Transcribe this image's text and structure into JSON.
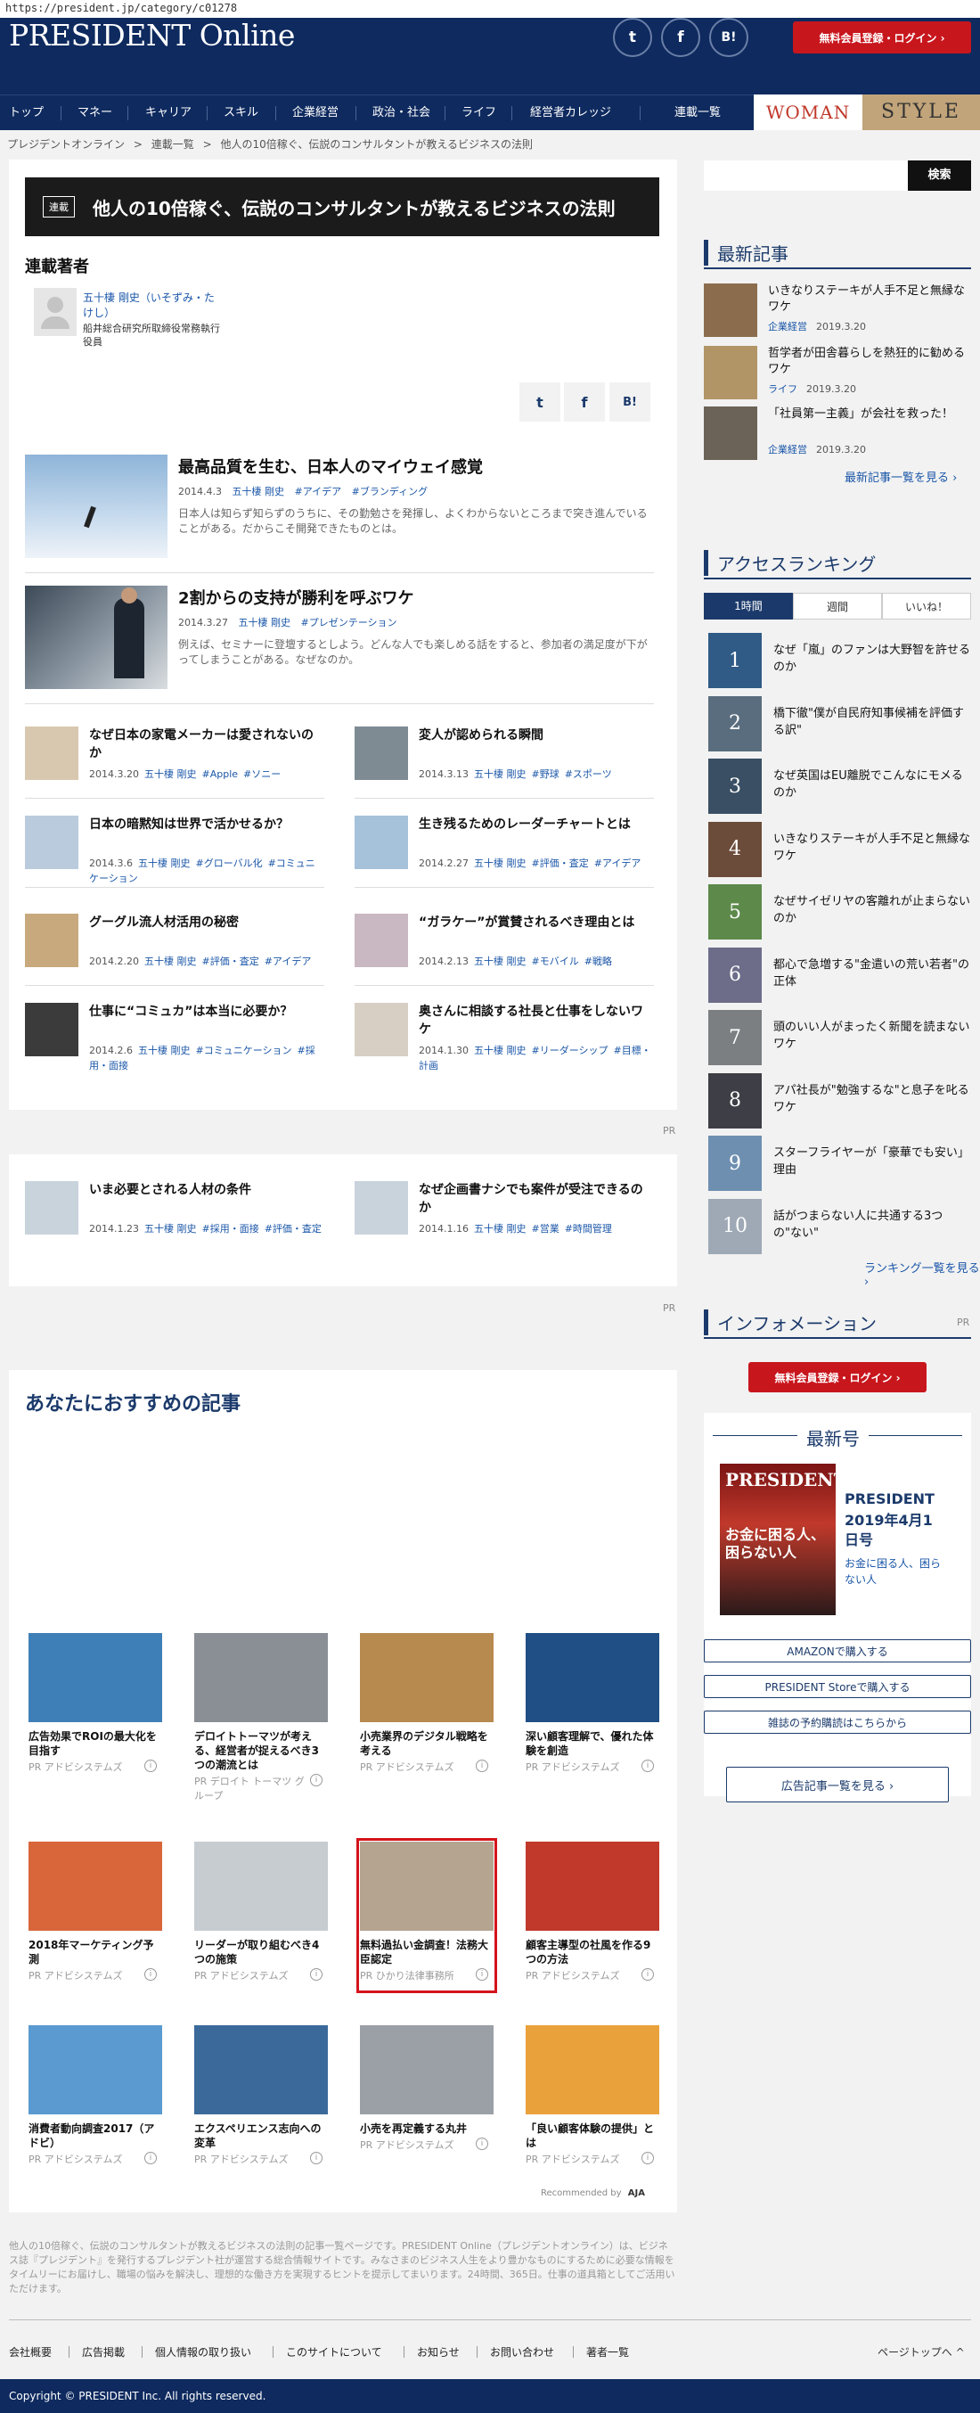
{
  "url": "https://president.jp/category/c01278",
  "header": {
    "logo": "PRESIDENT Online",
    "social": [
      "t",
      "f",
      "B!"
    ],
    "register": "無料会員登録・ログイン ›"
  },
  "nav": {
    "items": [
      "トップ",
      "マネー",
      "キャリア",
      "スキル",
      "企業経営",
      "政治・社会",
      "ライフ",
      "経営者カレッジ"
    ],
    "series": "連載一覧",
    "woman": "WOMAN",
    "style": "STYLE"
  },
  "breadcrumb": [
    "プレジデントオンライン",
    ">",
    "連載一覧",
    ">",
    "他人の10倍稼ぐ、伝説のコンサルタントが教えるビジネスの法則"
  ],
  "series": {
    "badge": "連載",
    "title": "他人の10倍稼ぐ、伝説のコンサルタントが教えるビジネスの法則",
    "author_heading": "連載著者",
    "author_name": "五十棲 剛史（いそずみ・たけし）",
    "author_role": "船井総合研究所取締役常務執行役員"
  },
  "share": [
    "t",
    "f",
    "B!"
  ],
  "featured": [
    {
      "title": "最高品質を生む、日本人のマイウェイ感覚",
      "date": "2014.4.3",
      "author": "五十棲 剛史",
      "tags": [
        "#アイデア",
        "#ブランディング"
      ],
      "desc": "日本人は知らず知らずのうちに、その勤勉さを発揮し、よくわからないところまで突き進んでいることがある。だからこそ開発できたものとは。"
    },
    {
      "title": "2割からの支持が勝利を呼ぶワケ",
      "date": "2014.3.27",
      "author": "五十棲 剛史",
      "tags": [
        "#プレゼンテーション"
      ],
      "desc": "例えば、セミナーに登壇するとしよう。どんな人でも楽しめる話をすると、参加者の満足度が下がってしまうことがある。なぜなのか。"
    }
  ],
  "grid": [
    {
      "title": "なぜ日本の家電メーカーは愛されないのか",
      "date": "2014.3.20",
      "author": "五十棲 剛史",
      "tags": [
        "#Apple",
        "#ソニー"
      ]
    },
    {
      "title": "変人が認められる瞬間",
      "date": "2014.3.13",
      "author": "五十棲 剛史",
      "tags": [
        "#野球",
        "#スポーツ"
      ]
    },
    {
      "title": "日本の暗黙知は世界で活かせるか？",
      "date": "2014.3.6",
      "author": "五十棲 剛史",
      "tags": [
        "#グローバル化",
        "#コミュニケーション"
      ]
    },
    {
      "title": "生き残るためのレーダーチャートとは",
      "date": "2014.2.27",
      "author": "五十棲 剛史",
      "tags": [
        "#評価・査定",
        "#アイデア"
      ]
    },
    {
      "title": "グーグル流人材活用の秘密",
      "date": "2014.2.20",
      "author": "五十棲 剛史",
      "tags": [
        "#評価・査定",
        "#アイデア"
      ]
    },
    {
      "title": "“ガラケー”が賞賛されるべき理由とは",
      "date": "2014.2.13",
      "author": "五十棲 剛史",
      "tags": [
        "#モバイル",
        "#戦略"
      ]
    },
    {
      "title": "仕事に“コミュカ”は本当に必要か？",
      "date": "2014.2.6",
      "author": "五十棲 剛史",
      "tags": [
        "#コミュニケーション",
        "#採用・面接"
      ]
    },
    {
      "title": "奥さんに相談する社長と仕事をしないワケ",
      "date": "2014.1.30",
      "author": "五十棲 剛史",
      "tags": [
        "#リーダーシップ",
        "#目標・計画"
      ]
    }
  ],
  "pr_label": "PR",
  "grid2": [
    {
      "title": "いま必要とされる人材の条件",
      "date": "2014.1.23",
      "author": "五十棲 剛史",
      "tags": [
        "#採用・面接",
        "#評価・査定"
      ]
    },
    {
      "title": "なぜ企画書ナシでも案件が受注できるのか",
      "date": "2014.1.16",
      "author": "五十棲 剛史",
      "tags": [
        "#営業",
        "#時間管理"
      ]
    }
  ],
  "recommend": {
    "heading": "あなたにおすすめの記事",
    "items": [
      {
        "title": "広告効果でROIの最大化を目指す",
        "source": "PR アドビシステムズ"
      },
      {
        "title": "デロイトトーマツが考える、経営者が捉えるべき3つの潮流とは",
        "source": "PR デロイト トーマツ グループ"
      },
      {
        "title": "小売業界のデジタル戦略を考える",
        "source": "PR アドビシステムズ"
      },
      {
        "title": "深い顧客理解で、優れた体験を創造",
        "source": "PR アドビシステムズ"
      },
      {
        "title": "2018年マーケティング予測",
        "source": "PR アドビシステムズ"
      },
      {
        "title": "リーダーが取り組むべき4つの施策",
        "source": "PR アドビシステムズ"
      },
      {
        "title": "無料過払い金調査！法務大臣認定",
        "source": "PR ひかり法律事務所"
      },
      {
        "title": "顧客主導型の社風を作る9つの方法",
        "source": "PR アドビシステムズ"
      },
      {
        "title": "消費者動向調査2017（アドビ）",
        "source": "PR アドビシステムズ"
      },
      {
        "title": "エクスペリエンス志向への変革",
        "source": "PR アドビシステムズ"
      },
      {
        "title": "小売を再定義する丸井",
        "source": "PR アドビシステムズ"
      },
      {
        "title": "「良い顧客体験の提供」とは",
        "source": "PR アドビシステムズ"
      }
    ],
    "powered": "Recommended by",
    "powered_brand": "AJA"
  },
  "about": "他人の10倍稼ぐ、伝説のコンサルタントが教えるビジネスの法則の記事一覧ページです。PRESIDENT Online（プレジデントオンライン）は、ビジネス誌『プレジデント』を発行するプレジデント社が運営する総合情報サイトです。みなさまのビジネス人生をより豊かなものにするために必要な情報をタイムリーにお届けし、職場の悩みを解決し、理想的な働き方を実現するヒントを提示してまいります。24時間、365日。仕事の道具箱としてご活用いただけます。",
  "footer": {
    "links": [
      "会社概要",
      "広告掲載",
      "個人情報の取り扱い",
      "このサイトについて",
      "お知らせ",
      "お問い合わせ",
      "著者一覧"
    ],
    "pagetop": "ページトップへ ^",
    "copyright": "Copyright © PRESIDENT Inc. All rights reserved."
  },
  "sidebar": {
    "search_btn": "検索",
    "latest_heading": "最新記事",
    "latest": [
      {
        "title": "いきなりステーキが人手不足と無縁なワケ",
        "cat": "企業経営",
        "date": "2019.3.20"
      },
      {
        "title": "哲学者が田舎暮らしを熱狂的に勧めるワケ",
        "cat": "ライフ",
        "date": "2019.3.20"
      },
      {
        "title": "「社員第一主義」が会社を救った！",
        "cat": "企業経営",
        "date": "2019.3.20"
      }
    ],
    "latest_more": "最新記事一覧を見る ›",
    "ranking_heading": "アクセスランキング",
    "tabs": [
      "1時間",
      "週間",
      "いいね！"
    ],
    "ranking": [
      {
        "n": "1",
        "title": "なぜ「嵐」のファンは大野智を許せるのか"
      },
      {
        "n": "2",
        "title": "橋下徹\"僕が自民府知事候補を評価する訳\""
      },
      {
        "n": "3",
        "title": "なぜ英国はEU離脱でこんなにモメるのか"
      },
      {
        "n": "4",
        "title": "いきなりステーキが人手不足と無縁なワケ"
      },
      {
        "n": "5",
        "title": "なぜサイゼリヤの客離れが止まらないのか"
      },
      {
        "n": "6",
        "title": "都心で急増する\"金遣いの荒い若者\"の正体"
      },
      {
        "n": "7",
        "title": "頭のいい人がまったく新聞を読まないワケ"
      },
      {
        "n": "8",
        "title": "アパ社長が\"勉強するな\"と息子を叱るワケ"
      },
      {
        "n": "9",
        "title": "スターフライヤーが「豪華でも安い」理由"
      },
      {
        "n": "10",
        "title": "話がつまらない人に共通する3つの\"ない\""
      }
    ],
    "ranking_more": "ランキング一覧を見る ›",
    "info_heading": "インフォメーション",
    "pr": "PR",
    "register": "無料会員登録・ログイン ›",
    "latest_issue_heading": "最新号",
    "magazine": {
      "name": "PRESIDENT",
      "date": "2019年4月1日号",
      "sub": "お金に困る人、困らない人",
      "cover_title": "お金に困る人、困らない人",
      "cover_logo": "PRESIDENT"
    },
    "buy": [
      "AMAZONで購入する",
      "PRESIDENT Storeで購入する",
      "雑誌の予約購読はこちらから"
    ],
    "ad_more": "広告記事一覧を見る ›"
  },
  "colors": {
    "navy": "#0e2a5f",
    "red": "#c8161d",
    "accent_blue": "#1a56a8"
  }
}
